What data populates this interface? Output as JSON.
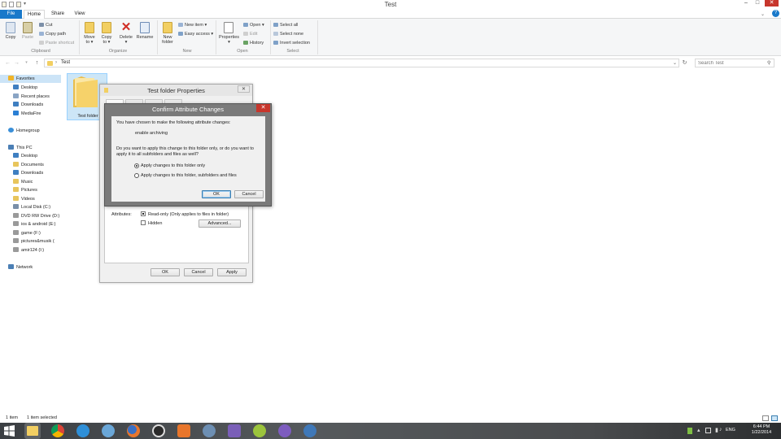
{
  "window": {
    "title": "Test",
    "minimize": "–",
    "maximize": "□",
    "close": "✕",
    "help": "?"
  },
  "ribbon": {
    "tabs": [
      "File",
      "Home",
      "Share",
      "View"
    ],
    "clipboard": {
      "copy": "Copy",
      "paste": "Paste",
      "cut": "Cut",
      "copy_path": "Copy path",
      "paste_shortcut": "Paste shortcut",
      "label": "Clipboard"
    },
    "organize": {
      "move_to": "Move\nto ▾",
      "copy_to": "Copy\nto ▾",
      "delete": "Delete\n▾",
      "rename": "Rename",
      "label": "Organize"
    },
    "new": {
      "new_folder": "New\nfolder",
      "new_item": "New item ▾",
      "easy_access": "Easy access ▾",
      "label": "New"
    },
    "open": {
      "properties": "Properties\n▾",
      "open": "Open ▾",
      "edit": "Edit",
      "history": "History",
      "label": "Open"
    },
    "select": {
      "select_all": "Select all",
      "select_none": "Select none",
      "invert_selection": "Invert selection",
      "label": "Select"
    }
  },
  "address": {
    "path": "Test",
    "search_placeholder": "Search Test"
  },
  "nav": {
    "favorites": "Favorites",
    "fav_items": [
      "Desktop",
      "Recent places",
      "Downloads",
      "MediaFire"
    ],
    "homegroup": "Homegroup",
    "this_pc": "This PC",
    "pc_items": [
      "Desktop",
      "Documents",
      "Downloads",
      "Music",
      "Pictures",
      "Videos",
      "Local Disk (C:)",
      "DVD RW Drive (D:)",
      "ios & android (E:)",
      "game (F:)",
      "pictures&musik (",
      "amir124 (I:)"
    ],
    "network": "Network"
  },
  "content": {
    "folder_name": "Test folder"
  },
  "properties": {
    "title": "Test folder Properties",
    "close": "✕",
    "attributes_label": "Attributes:",
    "readonly": "Read-only (Only applies to files in folder)",
    "hidden": "Hidden",
    "advanced": "Advanced...",
    "ok": "OK",
    "cancel": "Cancel",
    "apply": "Apply"
  },
  "confirm": {
    "title": "Confirm Attribute Changes",
    "close": "✕",
    "intro": "You have chosen to make the following attribute changes:",
    "change": "enable archiving",
    "question": "Do you want to apply this change to this folder only, or do you want to apply it to all subfolders and files as well?",
    "option1": "Apply changes to this folder only",
    "option2": "Apply changes to this folder, subfolders and files",
    "ok": "OK",
    "cancel": "Cancel"
  },
  "status": {
    "count": "1 item",
    "selected": "1 item selected"
  },
  "taskbar": {
    "lang": "ENG",
    "time": "6:44 PM",
    "date": "1/22/2014"
  },
  "colors": {
    "accent": "#1979ca",
    "close": "#c7362c",
    "folder": "#f4d26b"
  }
}
